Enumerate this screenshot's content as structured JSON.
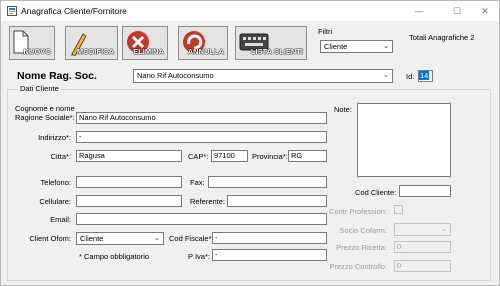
{
  "window": {
    "title": "Anagrafica Cliente/Fornitore",
    "minimize": "—",
    "maximize": "☐",
    "close": "✕"
  },
  "toolbar": {
    "nuovo": "NUOVO",
    "modifica": "MODIFICA",
    "elimina": "ELIMINA",
    "annulla": "ANNULLA",
    "lista": "LISTA CLIENTI"
  },
  "filtri": {
    "label": "Filtri",
    "value": "Cliente"
  },
  "totali": "Totali Anagrafiche 2",
  "header": {
    "label": "Nome Rag. Soc.",
    "value": "Nano Rif Autoconsumo",
    "id_label": "Id:",
    "id_value": "14"
  },
  "dati_cliente": {
    "title": "Dati Cliente",
    "cognome_label_1": "Cognome e nome",
    "cognome_label_2": "Ragione Sociale*:",
    "ragione_sociale": "Nano Rif Autoconsumo",
    "indirizzo_label": "Indirizzo*:",
    "indirizzo": "-",
    "citta_label": "Citta*:",
    "citta": "Ragusa",
    "cap_label": "CAP*:",
    "cap": "97100",
    "provincia_label": "Provincia*:",
    "provincia": "RG",
    "telefono_label": "Telefono:",
    "telefono": "",
    "fax_label": "Fax:",
    "fax": "",
    "cellulare_label": "Cellulare:",
    "cellulare": "",
    "referente_label": "Referente:",
    "referente": "",
    "email_label": "Email:",
    "email": "",
    "client_ofom_label": "Client Ofom:",
    "client_ofom": "Cliente",
    "cod_fiscale_label": "Cod Fiscale*:",
    "cod_fiscale": "-",
    "p_iva_label": "P Iva*:",
    "p_iva": "-",
    "campo_obbligatorio": "* Campo obbligatorio"
  },
  "right": {
    "note_label": "Note:",
    "cod_cliente_label": "Cod Cliente:",
    "cod_cliente": "",
    "contr_profession_label": "Contr Profession:",
    "socio_cofarm_label": "Socio Cofarm:",
    "prezzo_ricetta_label": "Prezzo Ricetta:",
    "prezzo_ricetta": "0",
    "prezzo_controllo_label": "Prezzo Controllo:",
    "prezzo_controllo": "0"
  },
  "colors": {
    "selection": "#0078d7",
    "toolbar_red": "#c0392b"
  },
  "icons": {
    "nuovo": "new-document-icon",
    "modifica": "pencil-icon",
    "elimina": "delete-x-icon",
    "annulla": "undo-icon",
    "lista": "keyboard-icon"
  }
}
